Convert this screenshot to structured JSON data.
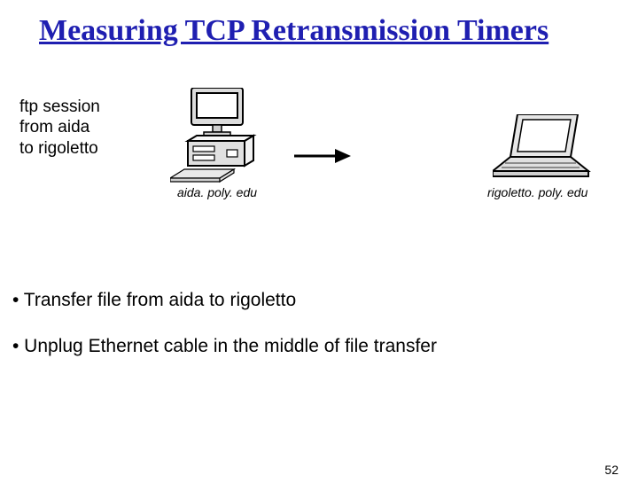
{
  "title": "Measuring TCP Retransmission Timers",
  "diagram": {
    "session_text": "ftp session\nfrom aida\nto rigoletto",
    "aida_host": "aida. poly. edu",
    "rigoletto_host": "rigoletto. poly. edu"
  },
  "bullets": {
    "b1": "• Transfer file from aida to rigoletto",
    "b2": "• Unplug Ethernet cable in the middle of file transfer"
  },
  "page_number": "52"
}
